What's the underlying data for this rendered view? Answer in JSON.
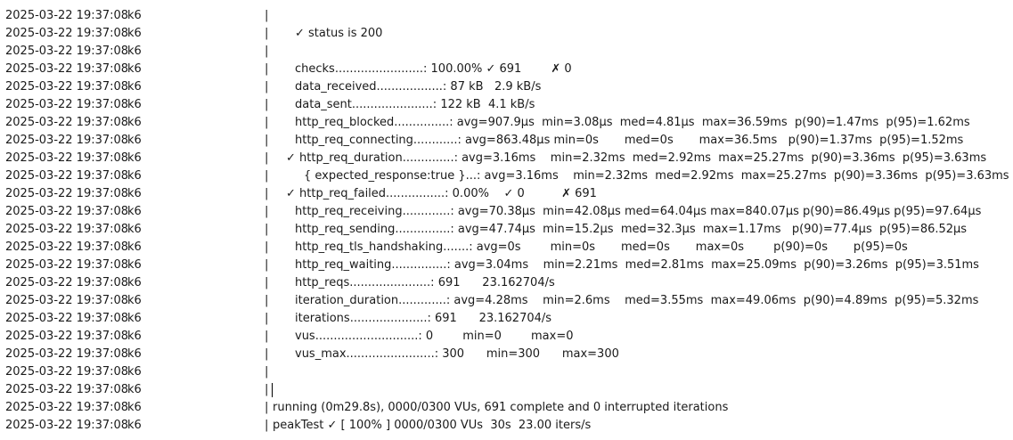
{
  "timestamp": "2025-03-22 19:37:08",
  "source": "k6",
  "rows": [
    {
      "kind": "empty",
      "text": ""
    },
    {
      "kind": "check",
      "text": "✓ status is 200"
    },
    {
      "kind": "empty",
      "text": ""
    },
    {
      "kind": "metric",
      "text": "checks........................: 100.00% ✓ 691        ✗ 0"
    },
    {
      "kind": "metric",
      "text": "data_received..................: 87 kB   2.9 kB/s"
    },
    {
      "kind": "metric",
      "text": "data_sent......................: 122 kB  4.1 kB/s"
    },
    {
      "kind": "metric",
      "text": "http_req_blocked...............: avg=907.9µs  min=3.08µs  med=4.81µs  max=36.59ms  p(90)=1.47ms  p(95)=1.62ms"
    },
    {
      "kind": "metric",
      "text": "http_req_connecting............: avg=863.48µs min=0s       med=0s       max=36.5ms   p(90)=1.37ms  p(95)=1.52ms"
    },
    {
      "kind": "metric-check",
      "text": "✓ http_req_duration..............: avg=3.16ms    min=2.32ms  med=2.92ms  max=25.27ms  p(90)=3.36ms  p(95)=3.63ms"
    },
    {
      "kind": "sub",
      "text": "{ expected_response:true }...: avg=3.16ms    min=2.32ms  med=2.92ms  max=25.27ms  p(90)=3.36ms  p(95)=3.63ms"
    },
    {
      "kind": "metric-check",
      "text": "✓ http_req_failed................: 0.00%    ✓ 0          ✗ 691"
    },
    {
      "kind": "metric",
      "text": "http_req_receiving.............: avg=70.38µs  min=42.08µs med=64.04µs max=840.07µs p(90)=86.49µs p(95)=97.64µs"
    },
    {
      "kind": "metric",
      "text": "http_req_sending...............: avg=47.74µs  min=15.2µs  med=32.3µs  max=1.17ms   p(90)=77.4µs  p(95)=86.52µs"
    },
    {
      "kind": "metric",
      "text": "http_req_tls_handshaking.......: avg=0s        min=0s       med=0s       max=0s        p(90)=0s       p(95)=0s"
    },
    {
      "kind": "metric",
      "text": "http_req_waiting...............: avg=3.04ms    min=2.21ms  med=2.81ms  max=25.09ms  p(90)=3.26ms  p(95)=3.51ms"
    },
    {
      "kind": "metric",
      "text": "http_reqs......................: 691      23.162704/s"
    },
    {
      "kind": "metric",
      "text": "iteration_duration.............: avg=4.28ms    min=2.6ms    med=3.55ms  max=49.06ms  p(90)=4.89ms  p(95)=5.32ms"
    },
    {
      "kind": "metric",
      "text": "iterations.....................: 691      23.162704/s"
    },
    {
      "kind": "metric",
      "text": "vus............................: 0        min=0        max=0"
    },
    {
      "kind": "metric",
      "text": "vus_max........................: 300      min=300      max=300"
    },
    {
      "kind": "empty",
      "text": ""
    },
    {
      "kind": "cursor",
      "text": ""
    },
    {
      "kind": "direct",
      "text": "running (0m29.8s), 0000/0300 VUs, 691 complete and 0 interrupted iterations"
    },
    {
      "kind": "direct",
      "text": "peakTest ✓ [ 100% ] 0000/0300 VUs  30s  23.00 iters/s"
    }
  ]
}
